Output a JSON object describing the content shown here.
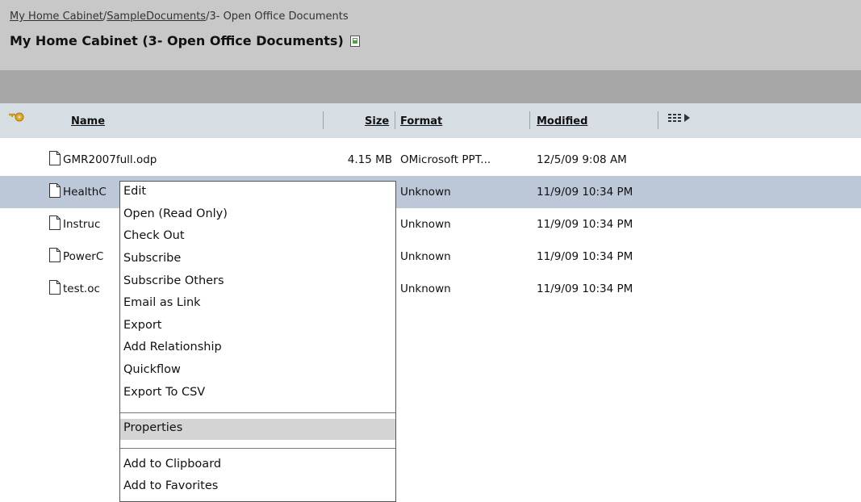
{
  "breadcrumb": {
    "items": [
      "My Home Cabinet",
      "SampleDocuments",
      "3- Open Office Documents"
    ],
    "separator": "/"
  },
  "header": {
    "title": "My Home Cabinet (3- Open Office Documents)",
    "title_icon": "document-icon"
  },
  "columns": {
    "name": "Name",
    "size": "Size",
    "format": "Format",
    "modified": "Modified"
  },
  "rows": [
    {
      "name": "GMR2007full.odp",
      "size": "4.15 MB",
      "format": "OMicrosoft PPT...",
      "modified": "12/5/09 9:08 AM",
      "selected": false
    },
    {
      "name": "HealthC",
      "size": "",
      "format": "Unknown",
      "modified": "11/9/09 10:34 PM",
      "selected": true
    },
    {
      "name": "Instruc",
      "size": "",
      "format": "Unknown",
      "modified": "11/9/09 10:34 PM",
      "selected": false
    },
    {
      "name": "PowerC",
      "size": "",
      "format": "Unknown",
      "modified": "11/9/09 10:34 PM",
      "selected": false
    },
    {
      "name": "test.oc",
      "size": "",
      "format": "Unknown",
      "modified": "11/9/09 10:34 PM",
      "selected": false
    }
  ],
  "context_menu": {
    "items": [
      "Edit",
      "Open (Read Only)",
      "Check Out",
      "Subscribe",
      "Subscribe Others",
      "Email as Link",
      "Export",
      "Add Relationship",
      "Quickflow",
      "Export To CSV",
      "Properties",
      "Add to Clipboard",
      "Add to Favorites"
    ],
    "hovered": "Properties"
  },
  "colors": {
    "header_bg": "#c8c8c8",
    "dark_bar": "#a7a7a7",
    "column_header_bg": "#d6dee4",
    "selected_row": "#bcc8d8",
    "menu_hover": "#d4d4d4"
  }
}
